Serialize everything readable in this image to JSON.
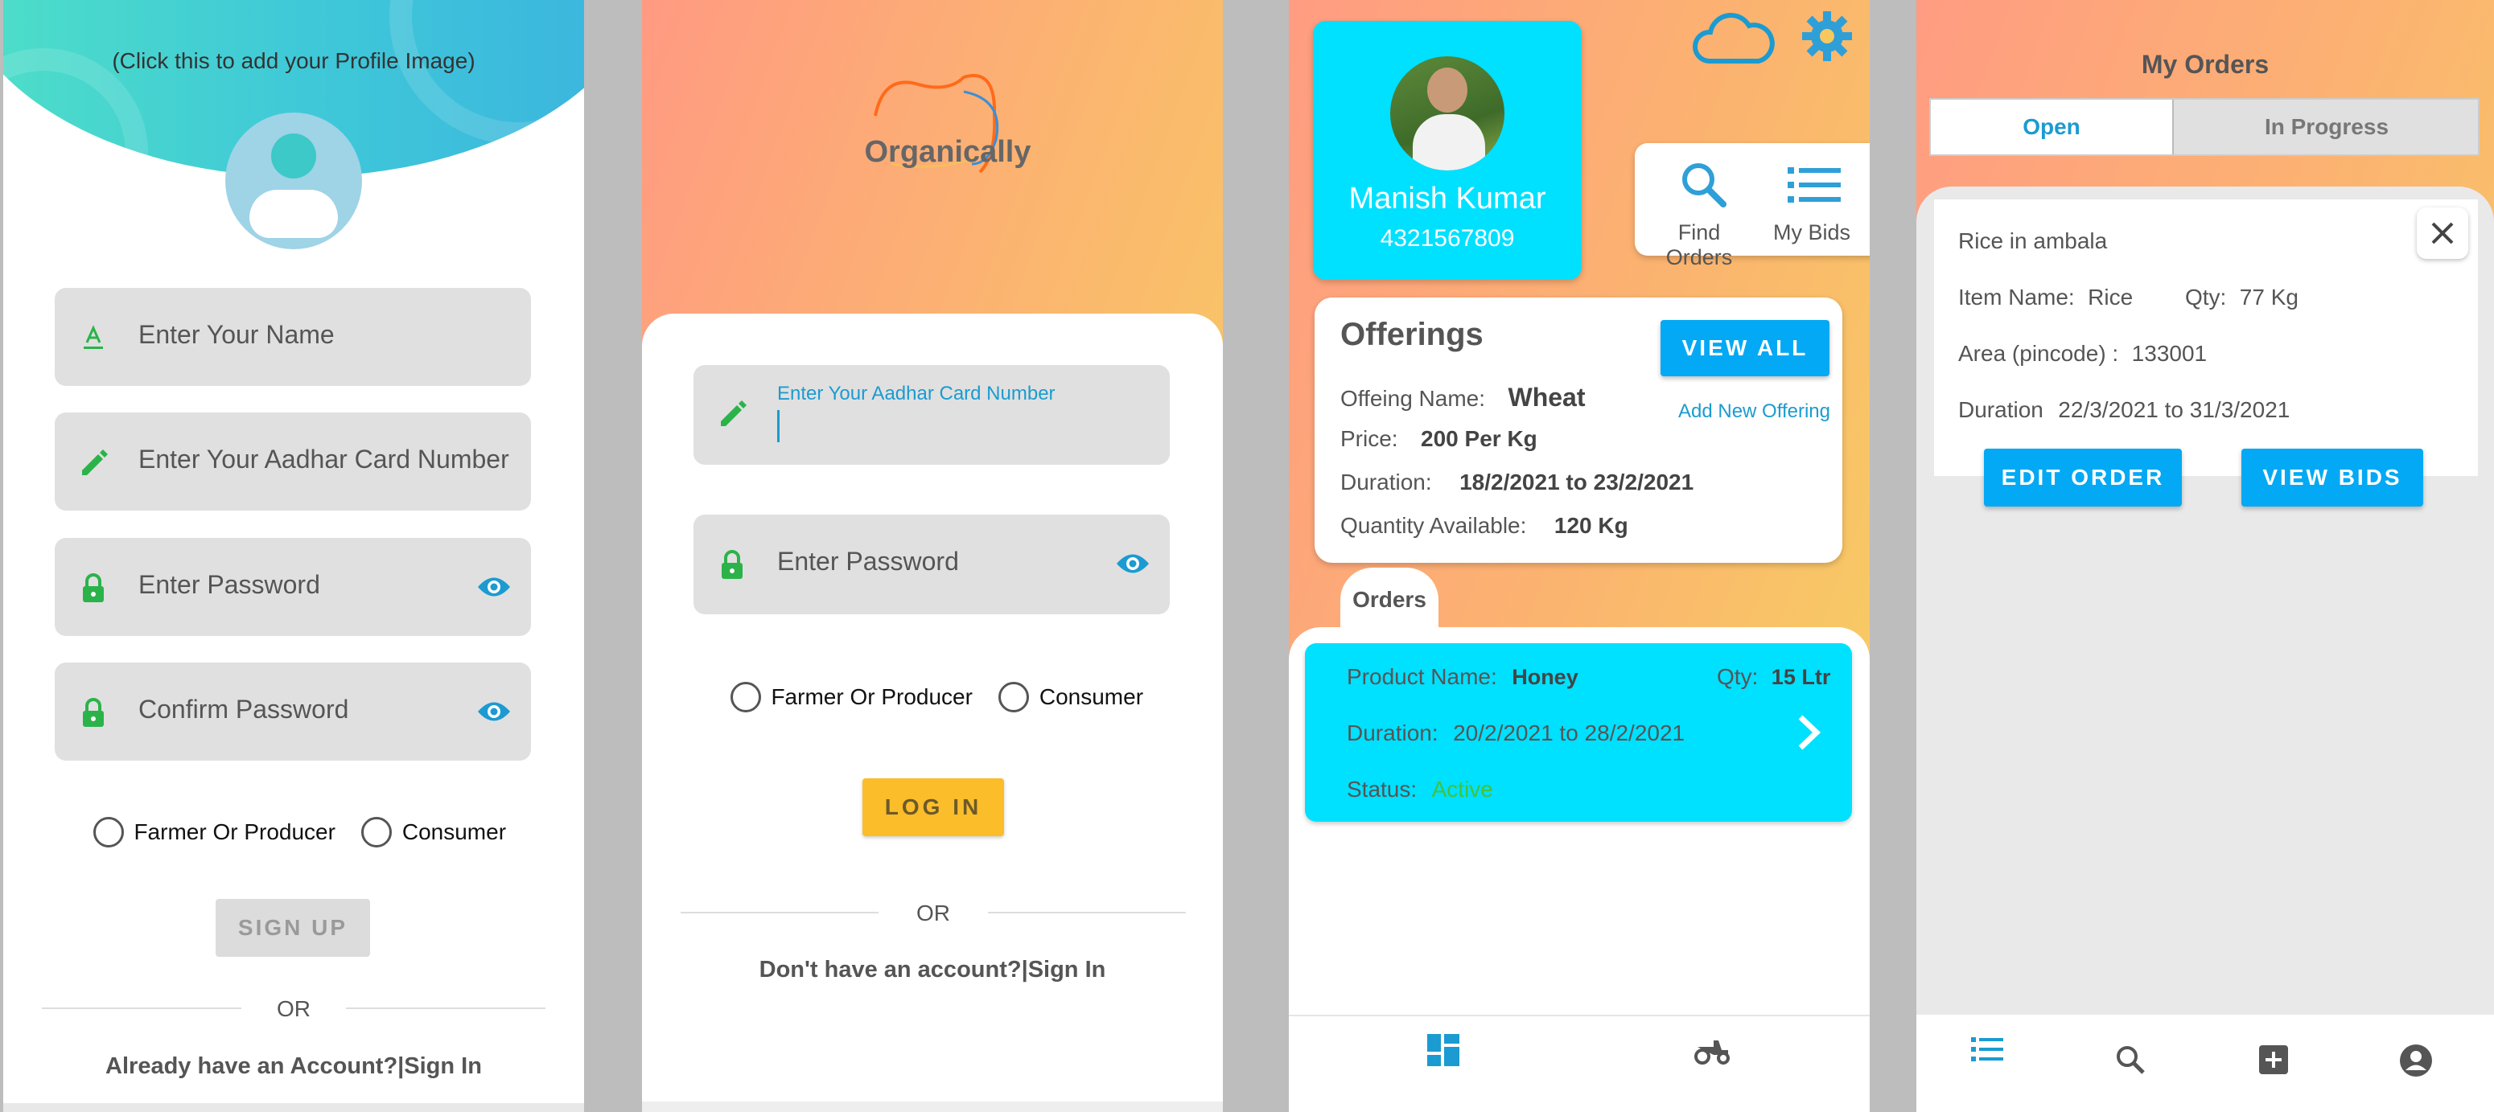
{
  "signup": {
    "profile_hint": "(Click this to add your Profile Image)",
    "name_placeholder": "Enter Your Name",
    "aadhar_placeholder": "Enter Your Aadhar Card Number",
    "password_placeholder": "Enter Password",
    "confirm_placeholder": "Confirm Password",
    "role_farmer": "Farmer Or Producer",
    "role_consumer": "Consumer",
    "signup_button": "SIGN UP",
    "or_text": "OR",
    "signin_link": "Already have an Account?|Sign In"
  },
  "login": {
    "logo_text": "Organically",
    "aadhar_label": "Enter Your Aadhar Card Number",
    "password_placeholder": "Enter Password",
    "role_farmer": "Farmer Or Producer",
    "role_consumer": "Consumer",
    "login_button": "LOG IN",
    "or_text": "OR",
    "signup_link": "Don't have an account?|Sign In"
  },
  "dashboard": {
    "profile_name": "Manish Kumar",
    "profile_phone": "4321567809",
    "find_orders": "Find Orders",
    "my_bids": "My Bids",
    "offerings_title": "Offerings",
    "view_all": "VIEW ALL",
    "add_offering": "Add New Offering",
    "offering_name_label": "Offeing Name:",
    "offering_name": "Wheat",
    "price_label": "Price:",
    "price": "200 Per Kg",
    "duration_label": "Duration:",
    "duration": "18/2/2021 to 23/2/2021",
    "quantity_label": "Quantity Available:",
    "quantity": "120 Kg",
    "orders_tab": "Orders",
    "order": {
      "product_label": "Product Name:",
      "product": "Honey",
      "qty_label": "Qty:",
      "qty": "15 Ltr",
      "duration_label": "Duration:",
      "duration": "20/2/2021 to 28/2/2021",
      "status_label": "Status:",
      "status": "Active"
    },
    "colors": {
      "accent": "#00e0ff",
      "icon": "#2f9fd8"
    }
  },
  "my_orders": {
    "title": "My Orders",
    "tab_open": "Open",
    "tab_progress": "In Progress",
    "order_title": "Rice in ambala",
    "item_label": "Item Name:",
    "item": "Rice",
    "qty_label": "Qty:",
    "qty": "77 Kg",
    "area_label": "Area (pincode) :",
    "area": "133001",
    "duration_label": "Duration",
    "duration": "22/3/2021 to 31/3/2021",
    "edit_button": "EDIT ORDER",
    "bids_button": "VIEW BIDS"
  }
}
